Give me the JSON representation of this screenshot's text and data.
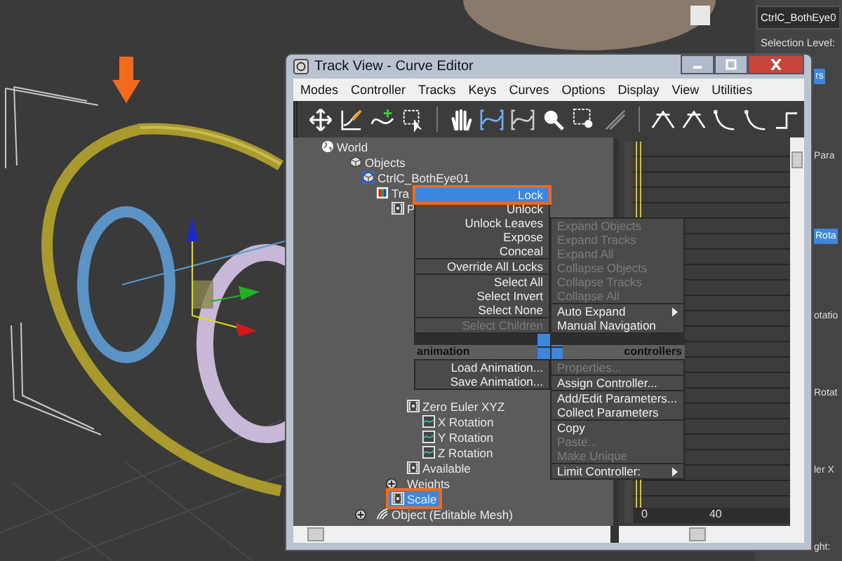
{
  "window": {
    "title": "Track View - Curve Editor"
  },
  "menu_bar": [
    "Modes",
    "Controller",
    "Tracks",
    "Keys",
    "Curves",
    "Options",
    "Display",
    "View",
    "Utilities"
  ],
  "tree": [
    {
      "label": "World",
      "kind": "world",
      "selected": false,
      "highlighted": false,
      "children": [
        {
          "label": "Objects",
          "kind": "objects",
          "selected": false,
          "highlighted": false,
          "children": [
            {
              "label": "CtrlC_BothEye01",
              "kind": "object",
              "selected": false,
              "highlighted": false,
              "children": [
                {
                  "label": "Tra",
                  "kind": "transform",
                  "selected": false,
                  "highlighted": false,
                  "children": [
                    {
                      "label": "P",
                      "kind": "controller",
                      "selected": false,
                      "highlighted": false,
                      "children": [
                        {
                          "label": "Zero Euler XYZ",
                          "kind": "controller",
                          "selected": false,
                          "highlighted": false,
                          "children": [
                            {
                              "label": "X Rotation",
                              "kind": "track",
                              "selected": false,
                              "highlighted": false
                            },
                            {
                              "label": "Y Rotation",
                              "kind": "track",
                              "selected": false,
                              "highlighted": false
                            },
                            {
                              "label": "Z Rotation",
                              "kind": "track",
                              "selected": false,
                              "highlighted": false
                            }
                          ]
                        },
                        {
                          "label": "Available",
                          "kind": "controller",
                          "selected": false,
                          "highlighted": false
                        },
                        {
                          "label": "Weights",
                          "kind": "plain",
                          "selected": false,
                          "highlighted": false,
                          "expanded": false
                        }
                      ]
                    },
                    {
                      "label": "Scale",
                      "kind": "controller",
                      "selected": true,
                      "highlighted": true
                    }
                  ]
                },
                {
                  "label": "Object (Editable Mesh)",
                  "kind": "mesh",
                  "selected": false,
                  "highlighted": false,
                  "expanded": false
                }
              ]
            }
          ]
        }
      ]
    }
  ],
  "quad_menu": {
    "quadrants": [
      {
        "items": [
          {
            "kind": "item",
            "label": "Lock",
            "selected": true,
            "disabled": false,
            "highlighted": true,
            "submenu": false
          },
          {
            "kind": "item",
            "label": "Unlock",
            "selected": false,
            "disabled": false,
            "highlighted": false,
            "submenu": false
          },
          {
            "kind": "item",
            "label": "Unlock Leaves",
            "selected": false,
            "disabled": false,
            "highlighted": false,
            "submenu": false
          },
          {
            "kind": "item",
            "label": "Expose",
            "selected": false,
            "disabled": false,
            "highlighted": false,
            "submenu": false
          },
          {
            "kind": "item",
            "label": "Conceal",
            "selected": false,
            "disabled": false,
            "highlighted": false,
            "submenu": false
          },
          {
            "kind": "separator"
          },
          {
            "kind": "item",
            "label": "Override All Locks",
            "selected": false,
            "disabled": false,
            "highlighted": false,
            "submenu": false
          },
          {
            "kind": "separator"
          },
          {
            "kind": "item",
            "label": "Select All",
            "selected": false,
            "disabled": false,
            "highlighted": false,
            "submenu": false
          },
          {
            "kind": "item",
            "label": "Select Invert",
            "selected": false,
            "disabled": false,
            "highlighted": false,
            "submenu": false
          },
          {
            "kind": "item",
            "label": "Select None",
            "selected": false,
            "disabled": false,
            "highlighted": false,
            "submenu": false
          },
          {
            "kind": "separator"
          },
          {
            "kind": "item",
            "label": "Select Children",
            "selected": false,
            "disabled": true,
            "highlighted": false,
            "submenu": false
          }
        ]
      },
      {
        "items": [
          {
            "kind": "item",
            "label": "Expand Objects",
            "selected": false,
            "disabled": true,
            "highlighted": false,
            "submenu": false
          },
          {
            "kind": "item",
            "label": "Expand Tracks",
            "selected": false,
            "disabled": true,
            "highlighted": false,
            "submenu": false
          },
          {
            "kind": "item",
            "label": "Expand All",
            "selected": false,
            "disabled": true,
            "highlighted": false,
            "submenu": false
          },
          {
            "kind": "item",
            "label": "Collapse Objects",
            "selected": false,
            "disabled": true,
            "highlighted": false,
            "submenu": false
          },
          {
            "kind": "item",
            "label": "Collapse Tracks",
            "selected": false,
            "disabled": true,
            "highlighted": false,
            "submenu": false
          },
          {
            "kind": "item",
            "label": "Collapse All",
            "selected": false,
            "disabled": true,
            "highlighted": false,
            "submenu": false
          },
          {
            "kind": "separator"
          },
          {
            "kind": "item",
            "label": "Auto Expand",
            "selected": false,
            "disabled": false,
            "highlighted": false,
            "submenu": true
          },
          {
            "kind": "item",
            "label": "Manual Navigation",
            "selected": false,
            "disabled": false,
            "highlighted": false,
            "submenu": false
          }
        ]
      },
      {
        "header": "animation",
        "items": [
          {
            "kind": "item",
            "label": "Load Animation...",
            "selected": false,
            "disabled": false,
            "highlighted": false,
            "submenu": false
          },
          {
            "kind": "item",
            "label": "Save Animation...",
            "selected": false,
            "disabled": false,
            "highlighted": false,
            "submenu": false
          }
        ]
      },
      {
        "header": "controllers",
        "items": [
          {
            "kind": "item",
            "label": "Properties...",
            "selected": false,
            "disabled": true,
            "highlighted": false,
            "submenu": false
          },
          {
            "kind": "separator"
          },
          {
            "kind": "item",
            "label": "Assign Controller...",
            "selected": false,
            "disabled": false,
            "highlighted": false,
            "submenu": false
          },
          {
            "kind": "separator"
          },
          {
            "kind": "item",
            "label": "Add/Edit Parameters...",
            "selected": false,
            "disabled": false,
            "highlighted": false
          },
          {
            "kind": "item",
            "label": "Collect Parameters",
            "selected": false,
            "disabled": false,
            "highlighted": false,
            "submenu": false
          },
          {
            "kind": "separator"
          },
          {
            "kind": "item",
            "label": "Copy",
            "selected": false,
            "disabled": false,
            "highlighted": false,
            "submenu": false
          },
          {
            "kind": "item",
            "label": "Paste...",
            "selected": false,
            "disabled": true,
            "highlighted": false,
            "submenu": false
          },
          {
            "kind": "item",
            "label": "Make Unique",
            "selected": false,
            "disabled": true,
            "highlighted": false,
            "submenu": false
          },
          {
            "kind": "separator"
          },
          {
            "kind": "item",
            "label": "Limit Controller:",
            "selected": false,
            "disabled": false,
            "highlighted": false,
            "submenu": true
          }
        ]
      }
    ]
  },
  "ruler": {
    "labels": [
      "0",
      "40"
    ]
  },
  "command_panel": {
    "object_name": "CtrlC_BothEye0",
    "selection_label": "Selection Level:",
    "fragments": [
      {
        "kind": "button",
        "label": "rs",
        "selected": true
      },
      {
        "kind": "label",
        "label": "Para"
      },
      {
        "kind": "button",
        "label": "Rota",
        "selected": true
      },
      {
        "kind": "label",
        "label": "otatio"
      },
      {
        "kind": "label",
        "label": "Rotat"
      },
      {
        "kind": "label",
        "label": "ler X"
      },
      {
        "kind": "label",
        "label": "ght:"
      }
    ]
  }
}
